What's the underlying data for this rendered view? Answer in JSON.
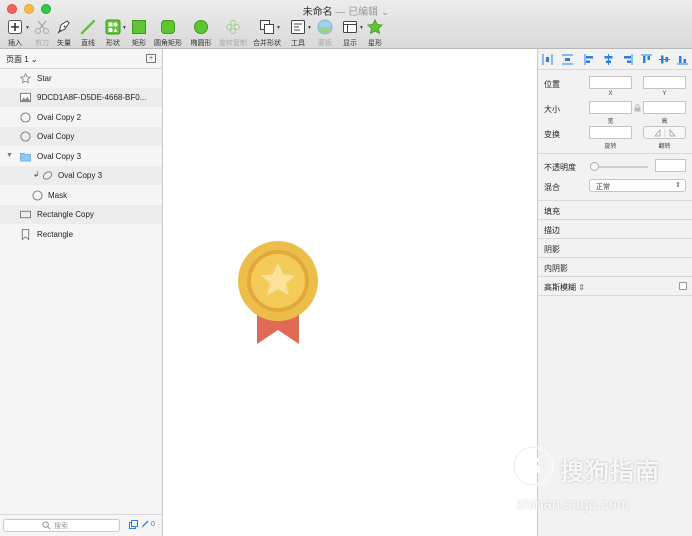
{
  "window": {
    "title": "未命名",
    "separator": "—",
    "edited": "已编辑",
    "edited_caret": "⌄"
  },
  "toolbar": [
    {
      "id": "insert",
      "label": "插入",
      "icon": "plus-square-icon"
    },
    {
      "id": "scissors",
      "label": "剪刀",
      "icon": "scissors-icon"
    },
    {
      "id": "vector",
      "label": "矢量",
      "icon": "pen-icon"
    },
    {
      "id": "line",
      "label": "直线",
      "icon": "line-icon"
    },
    {
      "id": "shape",
      "label": "形状",
      "icon": "shapes-icon"
    },
    {
      "id": "rect",
      "label": "矩形",
      "icon": "rectangle-icon"
    },
    {
      "id": "rounded",
      "label": "圆角矩形",
      "icon": "rounded-rectangle-icon"
    },
    {
      "id": "oval",
      "label": "椭圆形",
      "icon": "oval-icon"
    },
    {
      "id": "rotate_copy",
      "label": "旋转复制",
      "icon": "rotate-copy-icon"
    },
    {
      "id": "combine",
      "label": "合并形状",
      "icon": "combine-shapes-icon"
    },
    {
      "id": "tools",
      "label": "工具",
      "icon": "tools-icon"
    },
    {
      "id": "mask",
      "label": "蒙板",
      "icon": "mask-icon"
    },
    {
      "id": "view",
      "label": "显示",
      "icon": "view-icon"
    },
    {
      "id": "star",
      "label": "星形",
      "icon": "star-icon"
    }
  ],
  "pages": {
    "current": "页面 1",
    "caret": "⌄"
  },
  "layers": [
    {
      "name": "Star",
      "icon": "star-outline-icon"
    },
    {
      "name": "9DCD1A8F-D5DE-4668-BF0...",
      "icon": "image-icon"
    },
    {
      "name": "Oval Copy 2",
      "icon": "oval-outline-icon"
    },
    {
      "name": "Oval Copy",
      "icon": "oval-outline-icon"
    },
    {
      "name": "Oval Copy 3",
      "icon": "folder-icon"
    },
    {
      "name": "Oval Copy 3",
      "icon": "masked-oval-icon"
    },
    {
      "name": "Mask",
      "icon": "oval-outline-icon"
    },
    {
      "name": "Rectangle Copy",
      "icon": "rectangle-outline-icon"
    },
    {
      "name": "Rectangle",
      "icon": "bookmark-icon"
    }
  ],
  "search": {
    "placeholder": "搜索",
    "count": "0"
  },
  "inspector": {
    "position": {
      "label": "位置",
      "x": "X",
      "y": "Y"
    },
    "size": {
      "label": "大小",
      "w": "宽",
      "h": "高"
    },
    "transform": {
      "label": "变换",
      "rotate": "旋转",
      "flip": "翻转"
    },
    "opacity": {
      "label": "不透明度",
      "value": ""
    },
    "blend": {
      "label": "混合",
      "value": "正常"
    },
    "sections": [
      "填充",
      "描边",
      "阴影",
      "内阴影"
    ],
    "blur": {
      "label": "高斯模糊"
    }
  },
  "watermark": {
    "text": "搜狗指南",
    "url": "zhinan.sogo.com"
  },
  "colors": {
    "medal_outer": "#ecbd4a",
    "medal_inner": "#f4cb59",
    "medal_ring": "#e0a93a",
    "star": "#fbe29b",
    "ribbon": "#e06a55",
    "shape_green": "#5fc532",
    "selection_blue": "#2a7fe0"
  }
}
